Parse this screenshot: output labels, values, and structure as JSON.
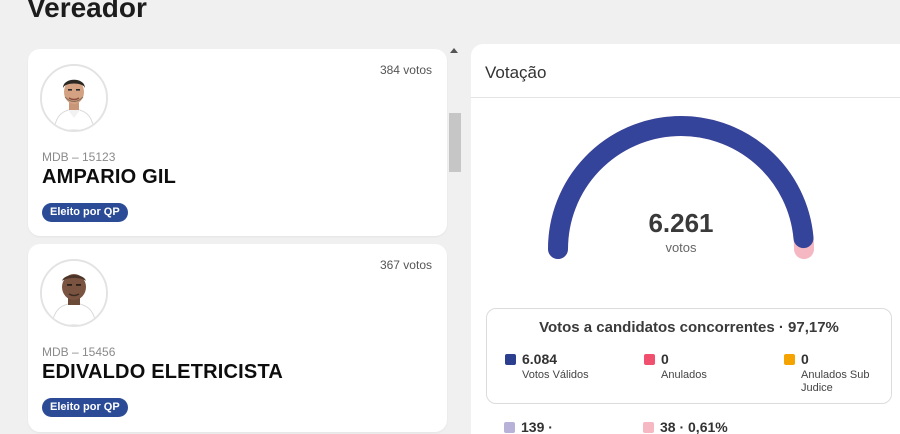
{
  "page": {
    "title": "Vereador"
  },
  "candidates": [
    {
      "votes": "384 votos",
      "party": "MDB – 15123",
      "name": "AMPARIO GIL",
      "badge": "Eleito por QP"
    },
    {
      "votes": "367 votos",
      "party": "MDB – 15456",
      "name": "EDIVALDO ELETRICISTA",
      "badge": "Eleito por QP"
    }
  ],
  "votacao": {
    "title": "Votação",
    "gauge": {
      "value": "6.261",
      "unit": "votos",
      "valid_fraction": 0.9717
    },
    "summary": {
      "title": "Votos a candidatos concorrentes · 97,17%",
      "stats": [
        {
          "value": "6.084",
          "label": "Votos Válidos",
          "color": "#2c3f8f"
        },
        {
          "value": "0",
          "label": "Anulados",
          "color": "#f0506e"
        },
        {
          "value": "0",
          "label": "Anulados Sub Judice",
          "color": "#f5a300"
        }
      ]
    },
    "other": [
      {
        "value": "139 ·",
        "color": "#b9b2d8"
      },
      {
        "value": "38 · 0,61%",
        "color": "#f6b9c4"
      }
    ]
  },
  "colors": {
    "brand": "#2c4b96",
    "gauge": "#33449a"
  },
  "icons": [
    "candidate-photo",
    "candidate-photo"
  ]
}
